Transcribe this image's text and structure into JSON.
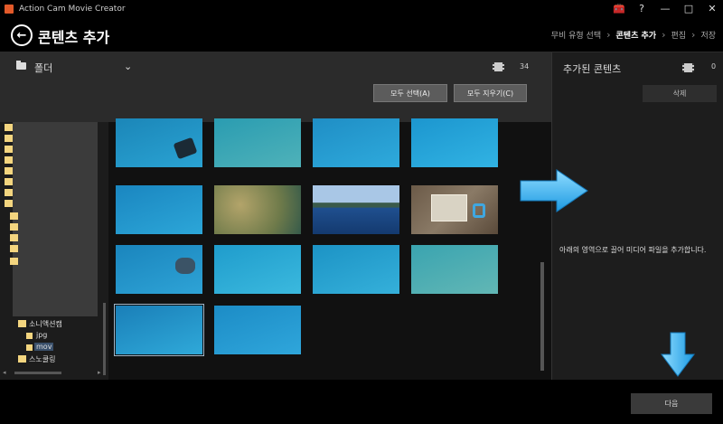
{
  "app": {
    "title": "Action Cam Movie Creator",
    "logo_color": "#e35a2a"
  },
  "window_controls": [
    {
      "name": "toolbox-icon",
      "symbol": "🧰"
    },
    {
      "name": "help-icon",
      "symbol": "?"
    },
    {
      "name": "minimize-icon",
      "symbol": "—"
    },
    {
      "name": "maximize-icon",
      "symbol": "□"
    },
    {
      "name": "close-icon",
      "symbol": "✕"
    }
  ],
  "header": {
    "back_symbol": "←",
    "page_title": "콘텐츠 추가",
    "steps": [
      "무비 유형 선택",
      "콘텐츠 추가",
      "편집",
      "저장"
    ],
    "active_step": "콘텐츠 추가",
    "step_separator": "›"
  },
  "folder_bar": {
    "label": "폴더",
    "dropdown_symbol": "⌄",
    "count": "34"
  },
  "actions": {
    "select_all": "모두 선택(A)",
    "clear_all": "모두 지우기(C)"
  },
  "tree": {
    "items": [
      {
        "label": "소니액션캠",
        "selected": false
      },
      {
        "label": "jpg",
        "selected": false
      },
      {
        "label": "mov",
        "selected": true
      },
      {
        "label": "스노쿨링",
        "selected": false
      }
    ]
  },
  "thumbnails": [
    {
      "kind": "underwater-diver",
      "colors": [
        "#1b86b8",
        "#2aa3d3"
      ]
    },
    {
      "kind": "reef",
      "colors": [
        "#2a9cb1",
        "#4fb2b9"
      ]
    },
    {
      "kind": "underwater",
      "colors": [
        "#1f8ec5",
        "#2eaadc"
      ]
    },
    {
      "kind": "underwater",
      "colors": [
        "#1c96cf",
        "#31b3e3"
      ]
    },
    {
      "kind": "underwater",
      "colors": [
        "#1a86c0",
        "#2ca6d8"
      ]
    },
    {
      "kind": "coral-reef",
      "colors": [
        "#8f8f4e",
        "#4f7a5a"
      ]
    },
    {
      "kind": "sea-island",
      "colors": [
        "#6f98c8",
        "#1f3f6f"
      ]
    },
    {
      "kind": "picnic-food",
      "colors": [
        "#7b6c5a",
        "#d7c7a6"
      ]
    },
    {
      "kind": "underwater-diver",
      "colors": [
        "#1a85bd",
        "#2ea3d6"
      ]
    },
    {
      "kind": "underwater",
      "colors": [
        "#1f9ccc",
        "#3bb9de"
      ]
    },
    {
      "kind": "underwater-diver",
      "colors": [
        "#1c93c5",
        "#35b0da"
      ]
    },
    {
      "kind": "reef",
      "colors": [
        "#3aa4b0",
        "#62b7b5"
      ]
    },
    {
      "kind": "underwater-surface",
      "colors": [
        "#1a7fb8",
        "#2fa9d9"
      ]
    },
    {
      "kind": "underwater",
      "colors": [
        "#1c8cc6",
        "#2fa6db"
      ]
    }
  ],
  "panel": {
    "title": "추가된 콘텐츠",
    "count": "0",
    "delete": "삭제",
    "hint": "아래의 영역으로 끌어 미디어 파일을 추가합니다."
  },
  "footer": {
    "next": "다음"
  },
  "colors": {
    "arrow": "#3fb6f2",
    "background": "#1a1a1a"
  }
}
